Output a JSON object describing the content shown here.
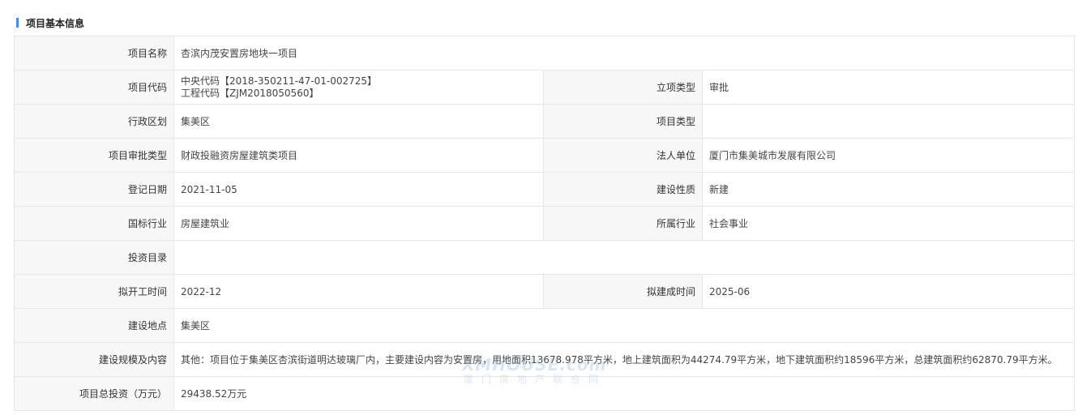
{
  "section": {
    "title": "项目基本信息"
  },
  "rows": {
    "name": {
      "label": "项目名称",
      "value": "杏滨内茂安置房地块一项目"
    },
    "code": {
      "label": "项目代码",
      "value_line1": "中央代码【2018-350211-47-01-002725】",
      "value_line2": "工程代码【ZJM2018050560】",
      "label2": "立项类型",
      "value2": "审批"
    },
    "region": {
      "label": "行政区划",
      "value": "集美区",
      "label2": "项目类型",
      "value2": ""
    },
    "approval": {
      "label": "项目审批类型",
      "value": "财政投融资房屋建筑类项目",
      "label2": "法人单位",
      "value2": "厦门市集美城市发展有限公司"
    },
    "reg_date": {
      "label": "登记日期",
      "value": "2021-11-05",
      "label2": "建设性质",
      "value2": "新建"
    },
    "industry": {
      "label": "国标行业",
      "value": "房屋建筑业",
      "label2": "所属行业",
      "value2": "社会事业"
    },
    "catalog": {
      "label": "投资目录",
      "value": ""
    },
    "dates": {
      "label": "拟开工时间",
      "value": "2022-12",
      "label2": "拟建成时间",
      "value2": "2025-06"
    },
    "location": {
      "label": "建设地点",
      "value": "集美区"
    },
    "scale": {
      "label": "建设规模及内容",
      "value": "其他：项目位于集美区杏滨街道明达玻璃厂内，主要建设内容为安置房，用地面积13678.978平方米，地上建筑面积为44274.79平方米，地下建筑面积约18596平方米，总建筑面积约62870.79平方米。"
    },
    "investment": {
      "label": "项目总投资（万元）",
      "value": "29438.52万元"
    }
  },
  "watermark": {
    "top": "XMHOUSE.com",
    "bottom": "厦门房地产联合网"
  },
  "colors": {
    "accent": "#3c8cff",
    "label_bg": "#f7f7f7",
    "border": "#e6e6e6"
  }
}
